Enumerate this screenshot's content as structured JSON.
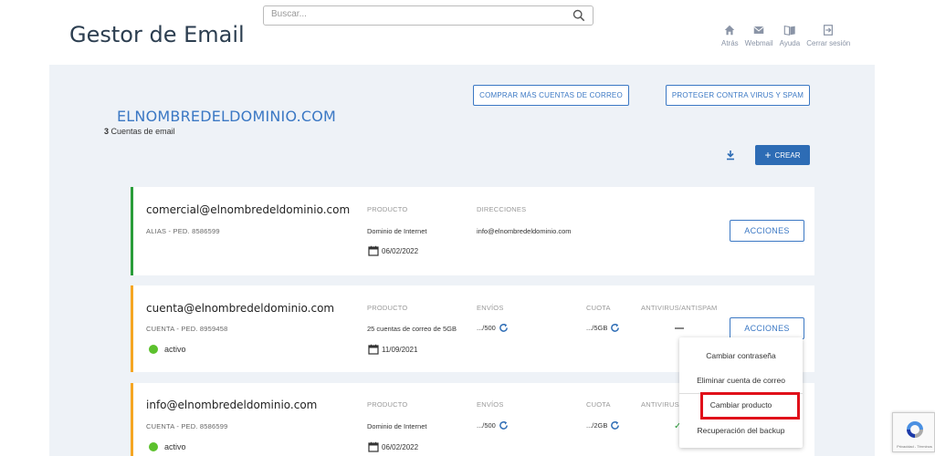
{
  "header": {
    "title": "Gestor de Email",
    "search_placeholder": "Buscar...",
    "nav": [
      {
        "label": "Atrás",
        "icon": "home-icon"
      },
      {
        "label": "Webmail",
        "icon": "mail-icon"
      },
      {
        "label": "Ayuda",
        "icon": "book-icon"
      },
      {
        "label": "Cerrar sesión",
        "icon": "logout-icon"
      }
    ]
  },
  "domain": {
    "name": "ELNOMBREDELDOMINIO.COM",
    "count": "3",
    "count_label": "Cuentas de email"
  },
  "buttons": {
    "buy": "COMPRAR MÁS CUENTAS DE CORREO",
    "protect": "PROTEGER CONTRA VIRUS Y SPAM",
    "crear": "CREAR"
  },
  "cards": [
    {
      "email": "comercial@elnombredeldominio.com",
      "sub": "ALIAS - PED. 8586599",
      "product_label": "PRODUCTO",
      "product": "Dominio de Internet",
      "date": "06/02/2022",
      "addresses_label": "DIRECCIONES",
      "addresses": "info@elnombredeldominio.com",
      "action": "ACCIONES",
      "status_color": "#2a9d3a"
    },
    {
      "email": "cuenta@elnombredeldominio.com",
      "sub": "CUENTA - PED. 8959458",
      "product_label": "PRODUCTO",
      "product": "25 cuentas de correo de 5GB",
      "date": "11/09/2021",
      "sends_label": "ENVÍOS",
      "sends": ".../500",
      "quota_label": "CUOTA",
      "quota": ".../5GB",
      "antivirus_label": "ANTIVIRUS/ANTISPAM",
      "status": "activo",
      "action": "ACCIONES",
      "status_color": "#f5a623"
    },
    {
      "email": "info@elnombredeldominio.com",
      "sub": "CUENTA - PED. 8586599",
      "product_label": "PRODUCTO",
      "product": "Dominio de Internet",
      "date": "06/02/2022",
      "sends_label": "ENVÍOS",
      "sends": ".../500",
      "quota_label": "CUOTA",
      "quota": ".../2GB",
      "antivirus_label": "ANTIVIRUS/",
      "status": "activo",
      "status_color": "#f5a623"
    }
  ],
  "dropdown": {
    "options": [
      "Cambiar contraseña",
      "Eliminar cuenta de correo",
      "Cambiar producto",
      "Recuperación del backup"
    ]
  },
  "recaptcha": {
    "text": "Privacidad - Términos"
  },
  "colors": {
    "accent": "#3b78c4",
    "primary_button": "#2d6cb5",
    "panel": "#eef2f7",
    "highlight": "#e0101a",
    "active": "#5cc12d"
  }
}
